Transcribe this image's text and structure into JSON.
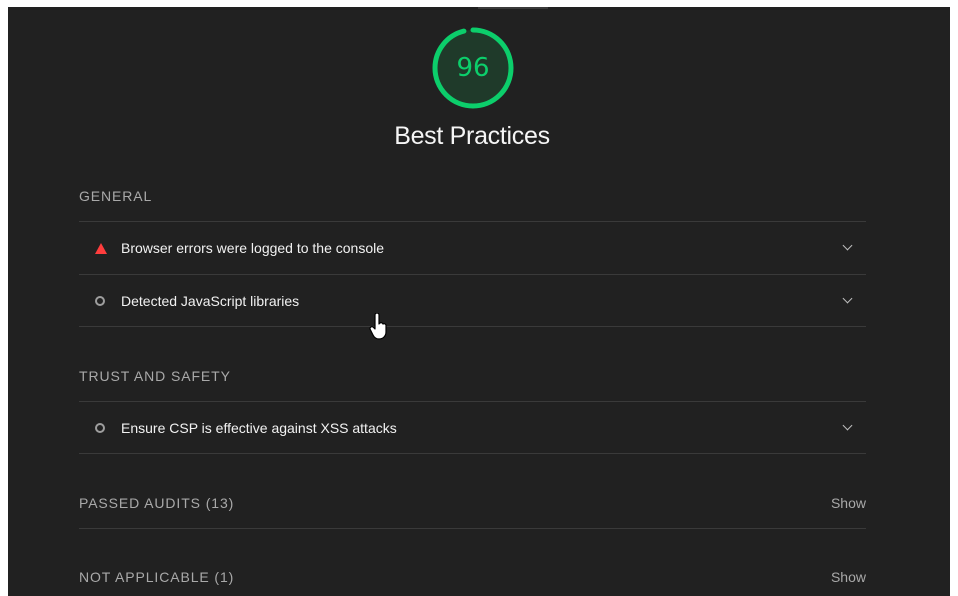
{
  "report": {
    "score": "96",
    "category_title": "Best Practices",
    "score_color": "#0cce6b",
    "fail_color": "#ff3d3d"
  },
  "groups": [
    {
      "label": "General",
      "audits": [
        {
          "title": "Browser errors were logged to the console",
          "icon": "warning-triangle-icon"
        },
        {
          "title": "Detected JavaScript libraries",
          "icon": "info-circle-icon"
        }
      ]
    },
    {
      "label": "Trust and Safety",
      "audits": [
        {
          "title": "Ensure CSP is effective against XSS attacks",
          "icon": "info-circle-icon"
        }
      ]
    }
  ],
  "clumps": [
    {
      "label": "Passed audits (13)",
      "action": "Show"
    },
    {
      "label": "Not applicable (1)",
      "action": "Show"
    }
  ]
}
